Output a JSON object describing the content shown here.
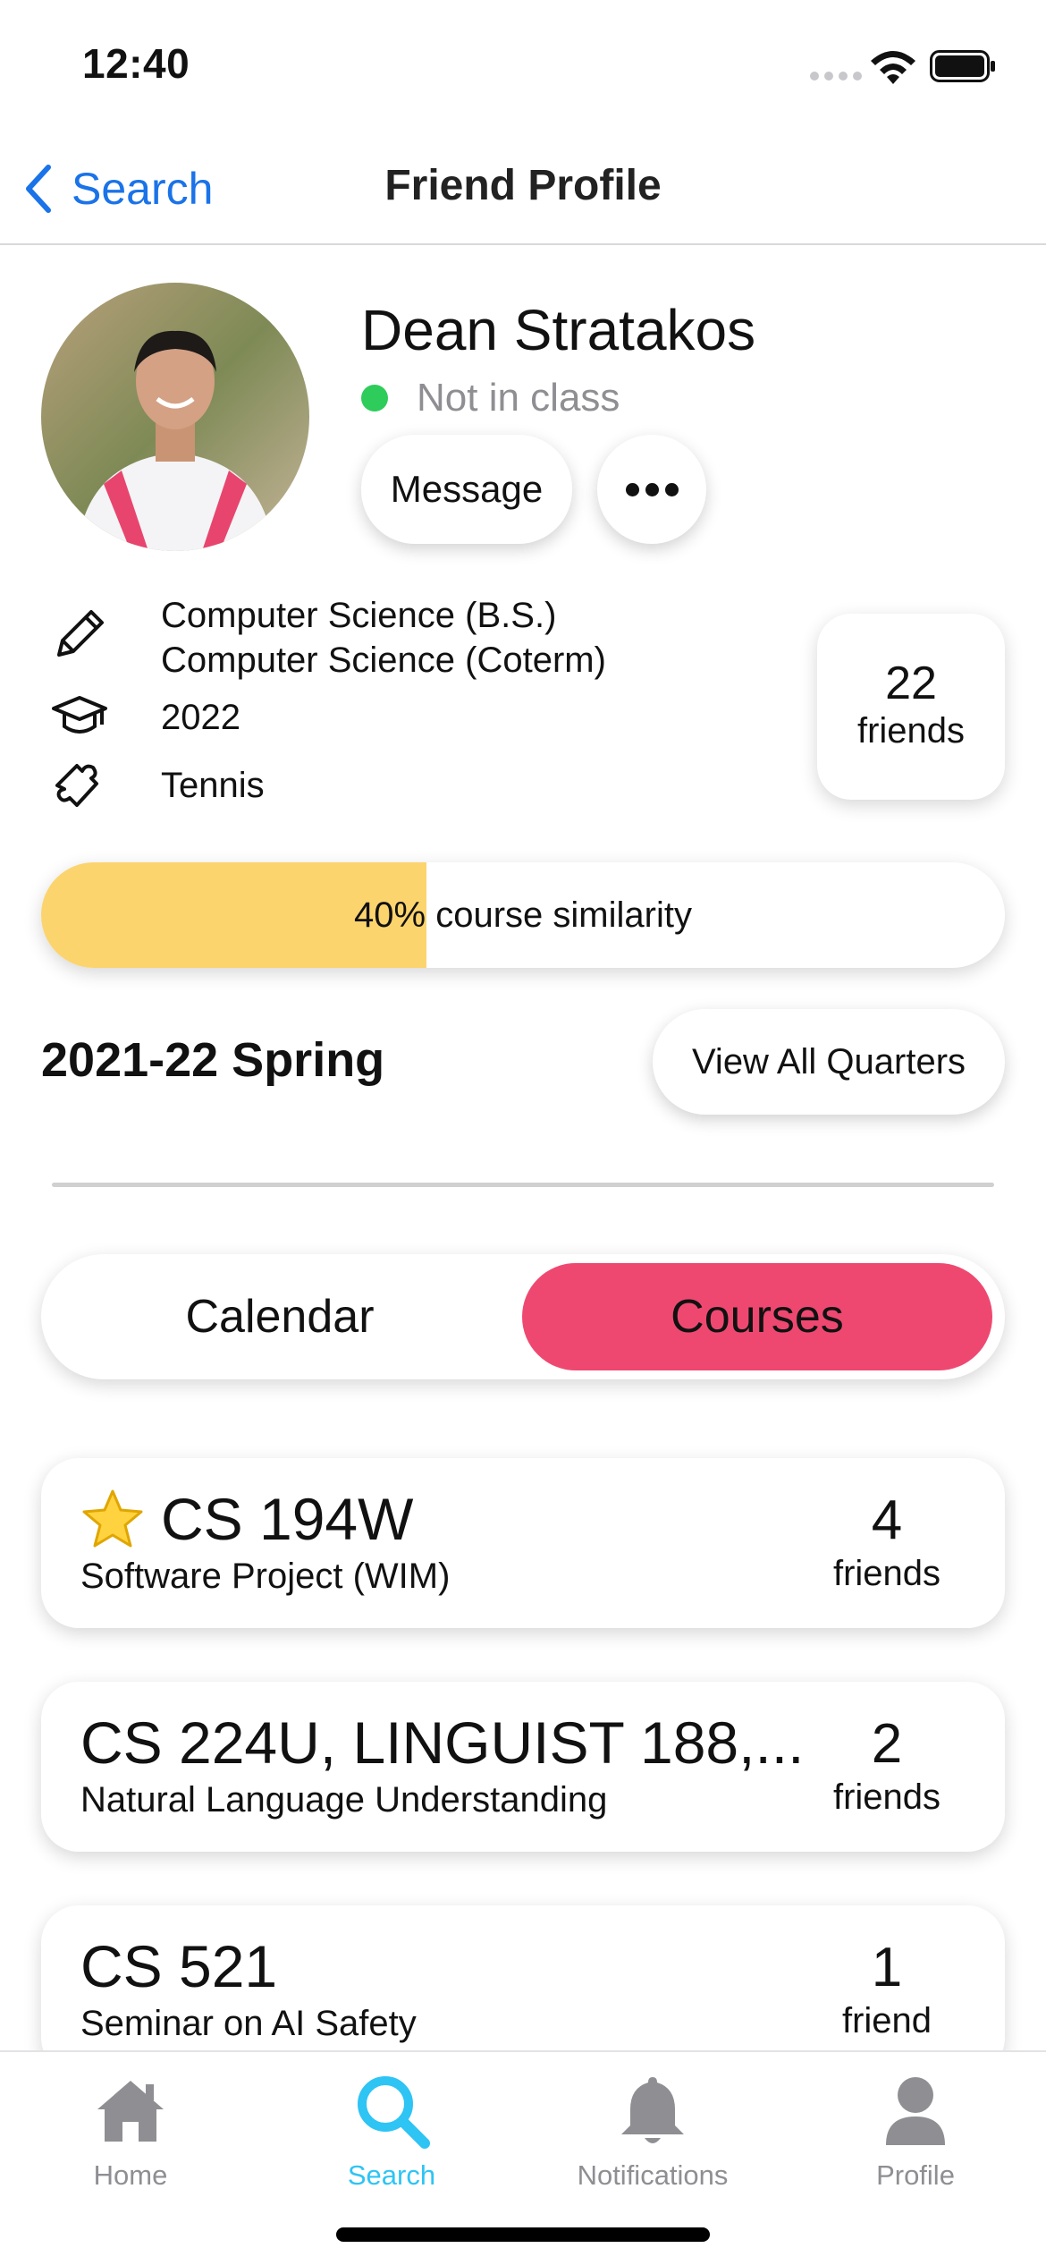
{
  "status_bar": {
    "time": "12:40"
  },
  "navbar": {
    "back_label": "Search",
    "title": "Friend Profile"
  },
  "profile": {
    "name": "Dean Stratakos",
    "presence": "Not in class",
    "presence_color": "#2ecc5b",
    "message_label": "Message",
    "majors": [
      "Computer Science (B.S.)",
      "Computer Science (Coterm)"
    ],
    "class_year": "2022",
    "activity": "Tennis",
    "friends_count": "22",
    "friends_label": "friends"
  },
  "similarity": {
    "value_percent": 40,
    "label": "40% course similarity",
    "fill_color": "#fcd46e"
  },
  "quarter": {
    "title": "2021-22 Spring",
    "view_all_label": "View All Quarters"
  },
  "segment": {
    "left_label": "Calendar",
    "right_label": "Courses",
    "selected": "Courses",
    "accent": "#ef4870"
  },
  "courses": [
    {
      "code": "CS 194W",
      "name": "Software Project (WIM)",
      "friends_count": "4",
      "friends_label": "friends",
      "starred": true
    },
    {
      "code": "CS 224U, LINGUIST 188,...",
      "name": "Natural Language Understanding",
      "friends_count": "2",
      "friends_label": "friends",
      "starred": false
    },
    {
      "code": "CS 521",
      "name": "Seminar on AI Safety",
      "friends_count": "1",
      "friends_label": "friend",
      "starred": false
    }
  ],
  "tabbar": {
    "items": [
      {
        "label": "Home",
        "icon": "home-icon"
      },
      {
        "label": "Search",
        "icon": "search-icon"
      },
      {
        "label": "Notifications",
        "icon": "bell-icon"
      },
      {
        "label": "Profile",
        "icon": "person-icon"
      }
    ],
    "active": "Search",
    "active_color": "#2ec4f4"
  }
}
